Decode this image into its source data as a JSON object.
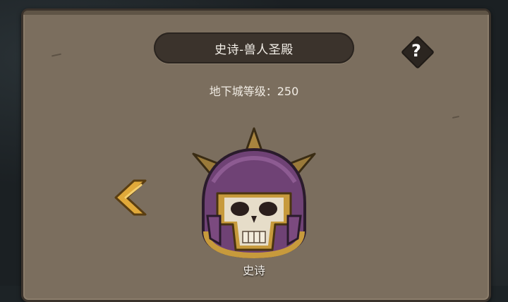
{
  "dungeon": {
    "title": "史诗-兽人圣殿",
    "level_text": "地下城等级：250",
    "boss_label": "史诗"
  },
  "icons": {
    "help": "question-diamond-icon",
    "prev": "chevron-left-icon",
    "boss": "orc-skull-helmet-icon"
  },
  "help_glyph": "?",
  "colors": {
    "panel": "#7b6e5e",
    "title_bar": "#3b332c",
    "accent_gold": "#e0a93a",
    "helmet_purple": "#7b4a7f"
  }
}
